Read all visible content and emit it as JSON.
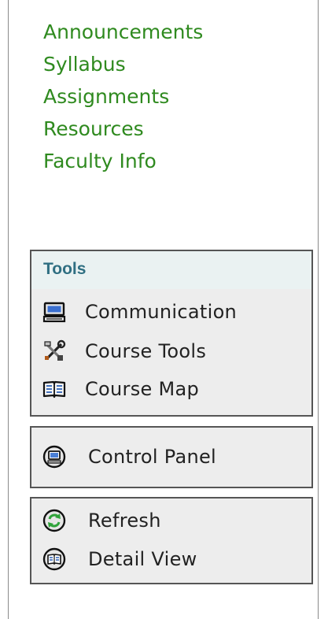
{
  "nav": {
    "links": [
      "Announcements",
      "Syllabus",
      "Assignments",
      "Resources",
      "Faculty Info"
    ]
  },
  "tools": {
    "header": "Tools",
    "items": [
      {
        "label": "Communication",
        "icon": "computer-icon"
      },
      {
        "label": "Course Tools",
        "icon": "tools-icon"
      },
      {
        "label": "Course Map",
        "icon": "book-icon"
      }
    ]
  },
  "panel": {
    "label": "Control Panel",
    "icon": "monitor-circle-icon"
  },
  "actions": {
    "items": [
      {
        "label": "Refresh",
        "icon": "refresh-icon"
      },
      {
        "label": "Detail View",
        "icon": "book-circle-icon"
      }
    ]
  },
  "colors": {
    "link": "#2f8a1f",
    "tools_header": "#2f6f82",
    "box_bg": "#ededed",
    "box_border": "#555555"
  }
}
